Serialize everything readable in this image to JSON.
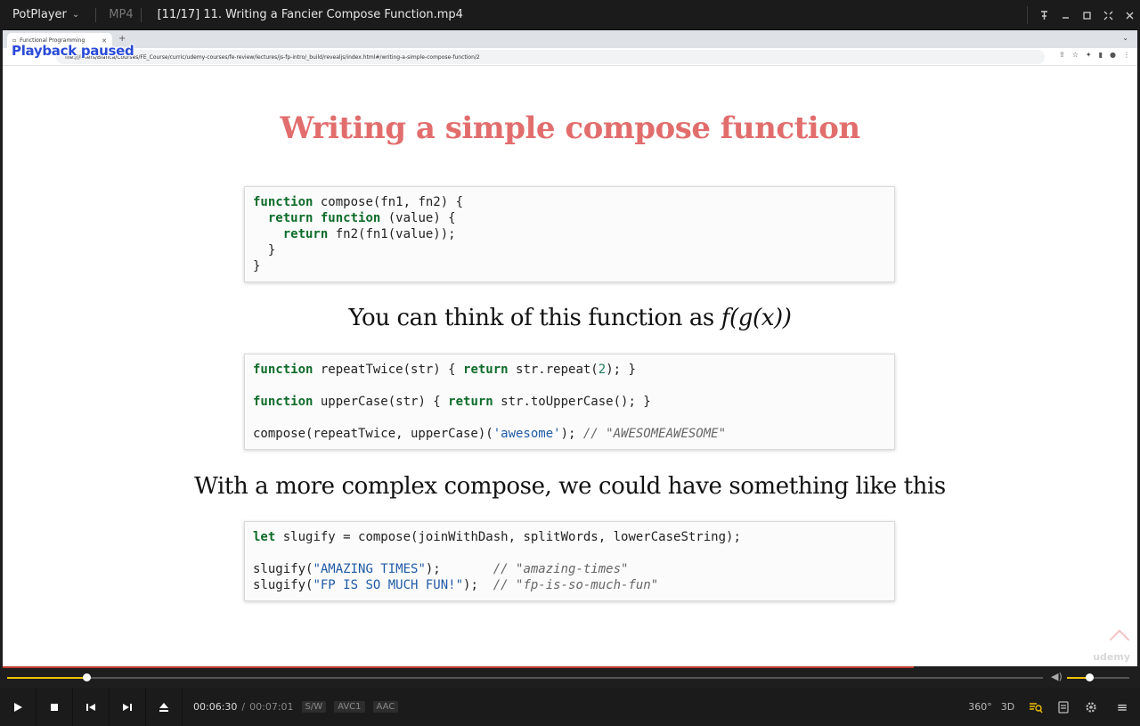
{
  "player": {
    "app_name": "PotPlayer",
    "format": "MP4",
    "title": "[11/17] 11. Writing a Fancier Compose Function.mp4",
    "window_icons": [
      "pin-icon",
      "minimize-icon",
      "maximize-icon",
      "fullscreen-icon",
      "close-icon"
    ]
  },
  "browser": {
    "tab_label": "Functional Programming",
    "url": "file:///Users/Bianca/Courses/FE_Course/curric/udemy-courses/fe-review/lectures/js-fp-intro/_build/revealjs/index.html#/writing-a-simple-compose-function/2",
    "osd_status": "Playback paused"
  },
  "slide": {
    "title": "Writing a simple compose function",
    "subheading1_text": "You can think of this function as ",
    "subheading1_math": "f(g(x))",
    "subheading2": "With a more complex compose, we could have something like this",
    "watermark": "udemy"
  },
  "playback": {
    "current_time": "00:06:30",
    "separator": "/",
    "total_time": "00:07:01",
    "badges": [
      "S/W",
      "AVC1",
      "AAC"
    ],
    "progress": 0.0765,
    "volume": 0.35,
    "buffered": 0.88,
    "right_labels": [
      "360°",
      "3D"
    ],
    "accent_color": "#f0c000"
  }
}
